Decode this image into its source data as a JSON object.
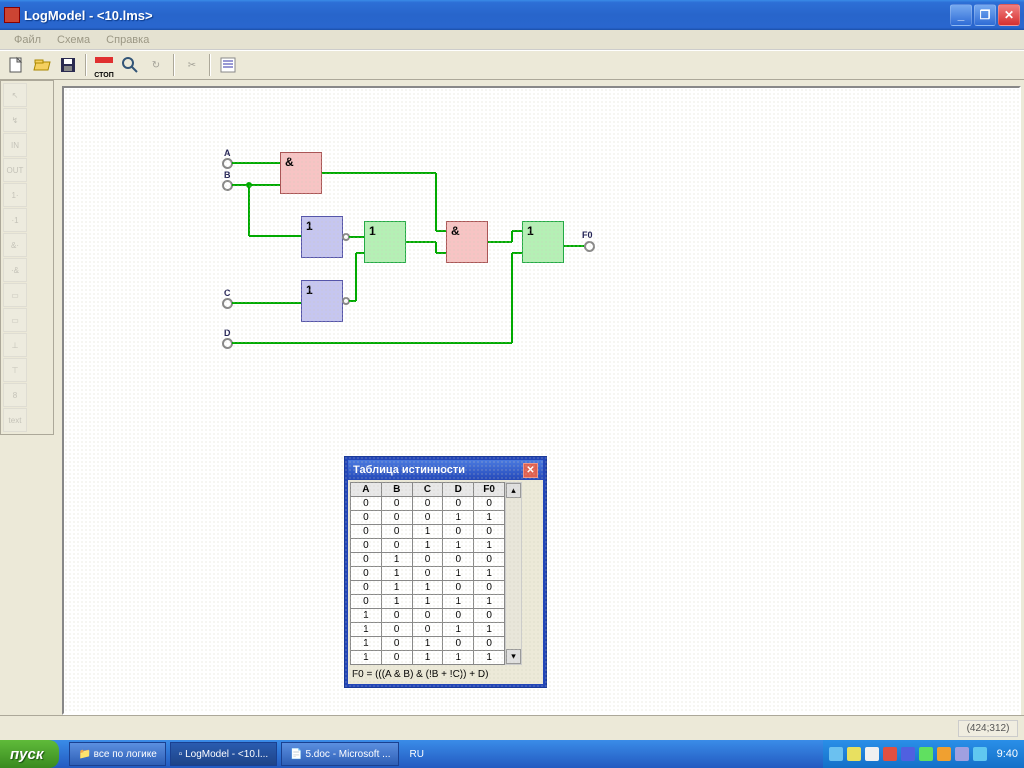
{
  "window": {
    "title": "LogModel - <10.lms>",
    "min": "_",
    "max": "❐",
    "close": "✕"
  },
  "menu": {
    "file": "Файл",
    "schema": "Схема",
    "help": "Справка"
  },
  "toolbar": {
    "new": "new",
    "open": "open",
    "save": "save",
    "stop": "СТОП",
    "zoom": "zoom",
    "refresh": "↻",
    "cut": "✂",
    "list": "☰"
  },
  "palette": {
    "pointer": "↖",
    "wire": "↯",
    "in": "IN",
    "out": "OUT",
    "one_a": "1·",
    "one_b": "·1",
    "and_a": "&·",
    "and_b": "·&",
    "mux_a": "▭",
    "mux_b": "▭",
    "sw_a": "⊥",
    "sw_b": "⊤",
    "disp": "8",
    "text": "text"
  },
  "inputs": {
    "A": "A",
    "B": "B",
    "C": "C",
    "D": "D",
    "F0": "F0"
  },
  "gates": {
    "and1": "&",
    "and2": "&",
    "or1": "1",
    "or2": "1",
    "not1": "1",
    "not2": "1"
  },
  "truthDialog": {
    "title": "Таблица истинности",
    "headers": [
      "A",
      "B",
      "C",
      "D",
      "F0"
    ],
    "rows": [
      [
        0,
        0,
        0,
        0,
        0
      ],
      [
        0,
        0,
        0,
        1,
        1
      ],
      [
        0,
        0,
        1,
        0,
        0
      ],
      [
        0,
        0,
        1,
        1,
        1
      ],
      [
        0,
        1,
        0,
        0,
        0
      ],
      [
        0,
        1,
        0,
        1,
        1
      ],
      [
        0,
        1,
        1,
        0,
        0
      ],
      [
        0,
        1,
        1,
        1,
        1
      ],
      [
        1,
        0,
        0,
        0,
        0
      ],
      [
        1,
        0,
        0,
        1,
        1
      ],
      [
        1,
        0,
        1,
        0,
        0
      ],
      [
        1,
        0,
        1,
        1,
        1
      ]
    ],
    "formula": "F0 = (((A & B) & (!B + !C)) + D)",
    "scrollUp": "▴",
    "scrollDown": "▾",
    "close": "✕"
  },
  "status": {
    "coords": "(424;312)"
  },
  "taskbar": {
    "start": "пуск",
    "tasks": [
      {
        "icon": "📁",
        "label": "все по логике"
      },
      {
        "icon": "▫",
        "label": "LogModel - <10.l..."
      },
      {
        "icon": "📄",
        "label": "5.doc - Microsoft ..."
      }
    ],
    "lang": "RU",
    "clock": "9:40"
  }
}
